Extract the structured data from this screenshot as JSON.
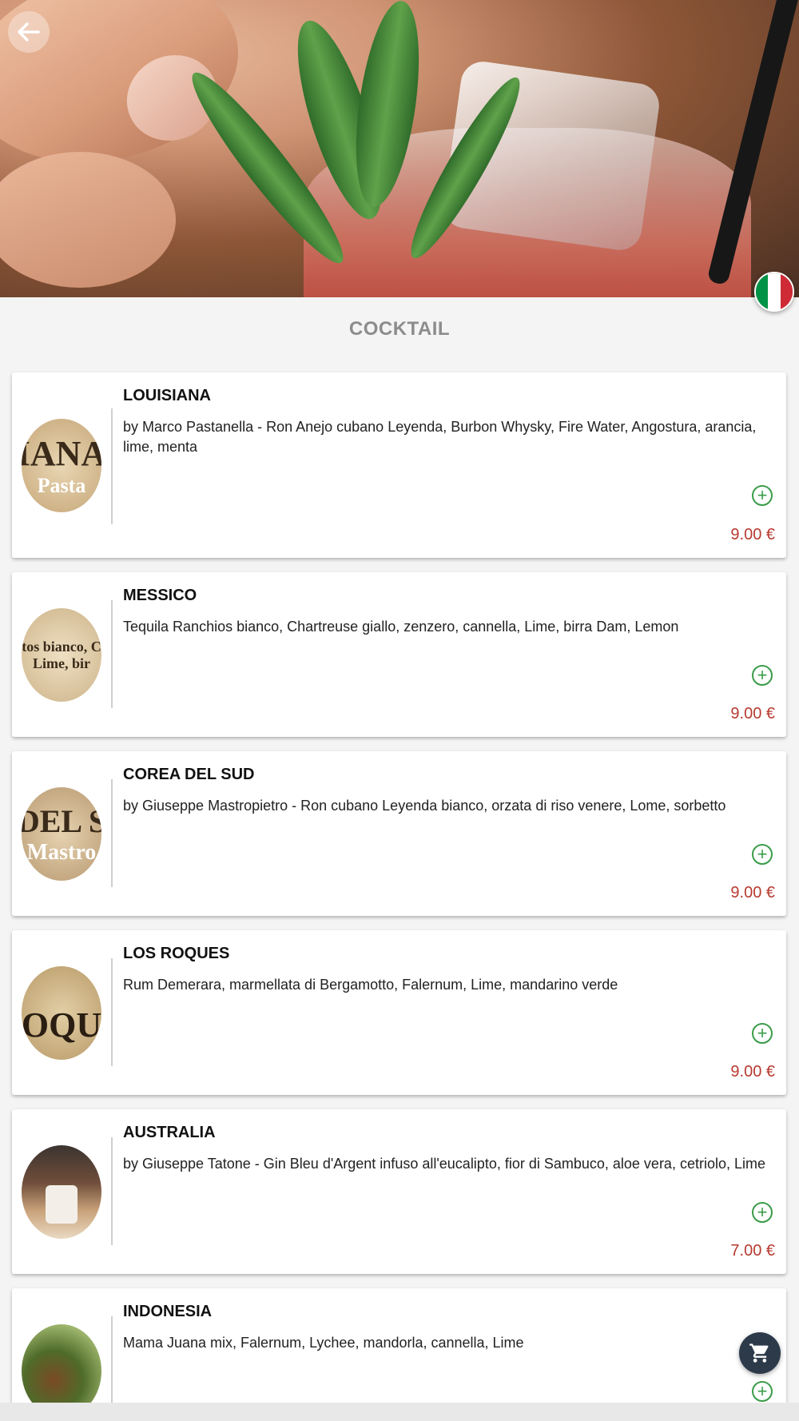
{
  "header": {
    "back_icon": "arrow-left-icon",
    "language_flag": {
      "name": "italy-flag-icon",
      "colors": [
        "#009246",
        "#ffffff",
        "#ce2b37"
      ]
    }
  },
  "section": {
    "title": "COCKTAIL"
  },
  "colors": {
    "add_icon": "#3a9c49",
    "price": "#b73a30",
    "cart_button": "#2c3a4a"
  },
  "items": [
    {
      "name": "LOUISIANA",
      "description": "by Marco Pastanella - Ron Anejo cubano Leyenda, Burbon Whysky, Fire Water, Angostura, arancia, lime, menta",
      "price": "9.00 €",
      "thumb_lines": [
        "IANA",
        "Pasta"
      ]
    },
    {
      "name": "MESSICO",
      "description": "Tequila Ranchios bianco, Chartreuse giallo, zenzero, cannella, Lime, birra Dam, Lemon",
      "price": "9.00 €",
      "thumb_lines": [
        "tos bianco, C",
        "Lime, bir"
      ]
    },
    {
      "name": "COREA DEL SUD",
      "description": "by Giuseppe Mastropietro - Ron cubano Leyenda bianco, orzata di riso venere, Lome, sorbetto",
      "price": "9.00 €",
      "thumb_lines": [
        "DEL S",
        "Mastro"
      ]
    },
    {
      "name": "LOS ROQUES",
      "description": "Rum Demerara, marmellata di Bergamotto, Falernum, Lime, mandarino verde",
      "price": "9.00 €",
      "thumb_lines": [
        "",
        "OQU"
      ]
    },
    {
      "name": "AUSTRALIA",
      "description": "by Giuseppe Tatone - Gin Bleu d'Argent infuso all'eucalipto, fior di Sambuco, aloe vera, cetriolo, Lime",
      "price": "7.00 €",
      "thumb_lines": [
        "",
        ""
      ]
    },
    {
      "name": "INDONESIA",
      "description": "Mama Juana mix, Falernum, Lychee, mandorla, cannella, Lime",
      "price": "",
      "thumb_lines": [
        "",
        ""
      ]
    }
  ],
  "cart": {
    "icon": "cart-icon"
  }
}
